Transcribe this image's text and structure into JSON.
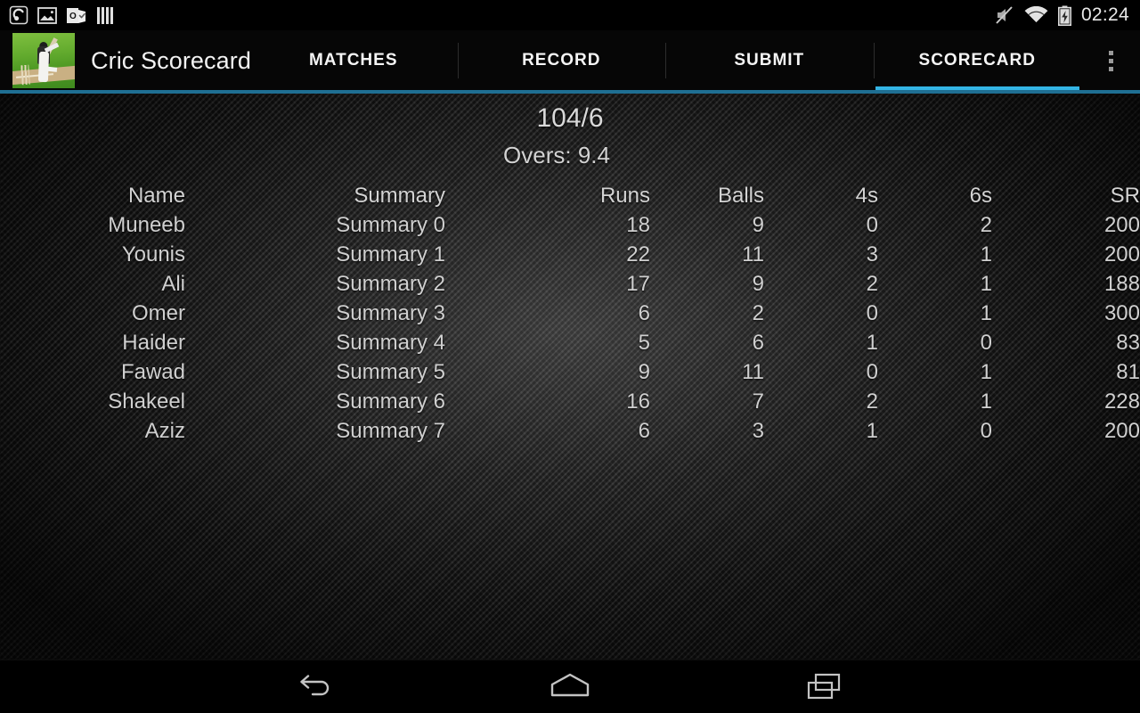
{
  "status_bar": {
    "notification_icons": [
      "headset-icon",
      "image-icon",
      "outlook-mail-icon",
      "bars-icon"
    ],
    "system_icons": [
      "mute-icon",
      "wifi-icon",
      "battery-charging-icon"
    ],
    "clock": "02:24"
  },
  "action_bar": {
    "app_icon": "cricket-batsman-icon",
    "app_title": "Cric Scorecard",
    "overflow_label": "overflow-menu-icon",
    "accent_color": "#33b5e5",
    "underline_color": "#1f6f93",
    "tabs": [
      {
        "label": "MATCHES",
        "active": false
      },
      {
        "label": "RECORD",
        "active": false
      },
      {
        "label": "SUBMIT",
        "active": false
      },
      {
        "label": "SCORECARD",
        "active": true
      }
    ]
  },
  "scorecard": {
    "total": "104/6",
    "overs": "Overs: 9.4",
    "columns": [
      "Name",
      "Summary",
      "Runs",
      "Balls",
      "4s",
      "6s",
      "SR"
    ],
    "rows": [
      {
        "name": "Muneeb",
        "summary": "Summary 0",
        "runs": "18",
        "balls": "9",
        "fours": "0",
        "sixes": "2",
        "sr": "200"
      },
      {
        "name": "Younis",
        "summary": "Summary 1",
        "runs": "22",
        "balls": "11",
        "fours": "3",
        "sixes": "1",
        "sr": "200"
      },
      {
        "name": "Ali",
        "summary": "Summary 2",
        "runs": "17",
        "balls": "9",
        "fours": "2",
        "sixes": "1",
        "sr": "188"
      },
      {
        "name": "Omer",
        "summary": "Summary 3",
        "runs": "6",
        "balls": "2",
        "fours": "0",
        "sixes": "1",
        "sr": "300"
      },
      {
        "name": "Haider",
        "summary": "Summary 4",
        "runs": "5",
        "balls": "6",
        "fours": "1",
        "sixes": "0",
        "sr": "83"
      },
      {
        "name": "Fawad",
        "summary": "Summary 5",
        "runs": "9",
        "balls": "11",
        "fours": "0",
        "sixes": "1",
        "sr": "81"
      },
      {
        "name": "Shakeel",
        "summary": "Summary 6",
        "runs": "16",
        "balls": "7",
        "fours": "2",
        "sixes": "1",
        "sr": "228"
      },
      {
        "name": "Aziz",
        "summary": "Summary 7",
        "runs": "6",
        "balls": "3",
        "fours": "1",
        "sixes": "0",
        "sr": "200"
      }
    ]
  },
  "nav_bar": {
    "buttons": [
      "back-icon",
      "home-icon",
      "recents-icon"
    ]
  }
}
